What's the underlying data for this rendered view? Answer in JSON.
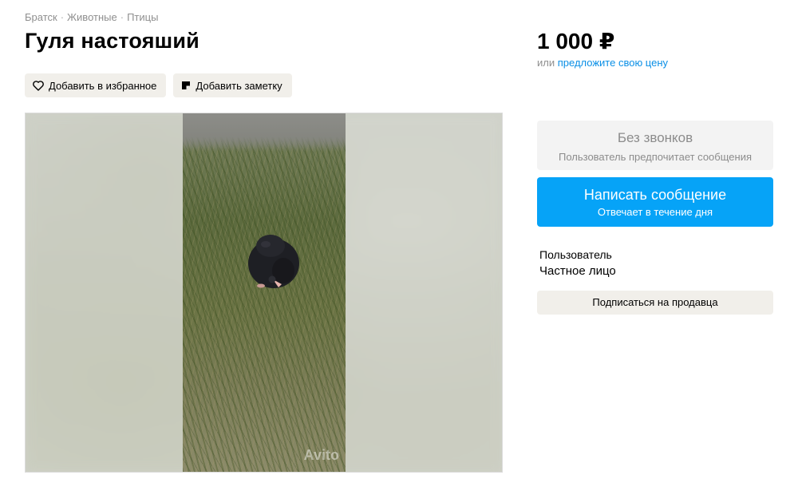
{
  "breadcrumb": [
    "Братск",
    "Животные",
    "Птицы"
  ],
  "breadcrumb_separator": "·",
  "title": "Гуля настояший",
  "actions": {
    "favorite_label": "Добавить в избранное",
    "note_label": "Добавить заметку"
  },
  "price": {
    "amount": "1 000 ₽",
    "offer_prefix": "или",
    "offer_link": "предложите свою цену"
  },
  "contact": {
    "no_calls_title": "Без звонков",
    "no_calls_subtitle": "Пользователь предпочитает сообщения",
    "write_title": "Написать сообщение",
    "write_subtitle": "Отвечает в течение дня"
  },
  "seller": {
    "type": "Пользователь",
    "name": "Частное лицо",
    "subscribe_label": "Подписаться на продавца"
  },
  "colors": {
    "accent": "#06a3f7",
    "link": "#0a8fe6",
    "button_gray": "#f1efea"
  }
}
